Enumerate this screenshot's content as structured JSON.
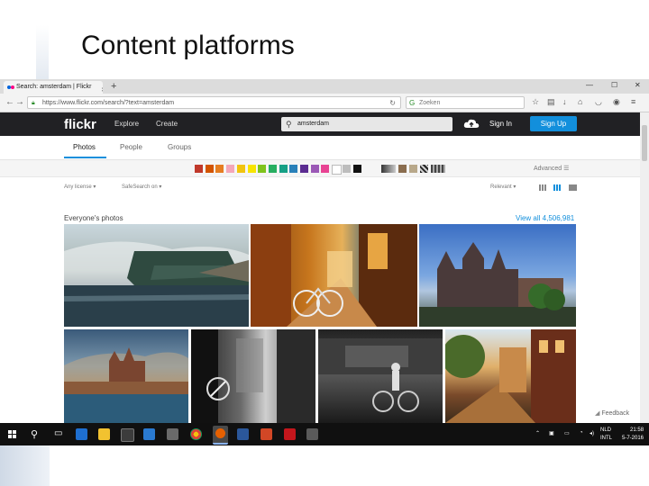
{
  "slide": {
    "title": "Content platforms"
  },
  "browser": {
    "tab_title": "Search: amsterdam | Flickr",
    "new_tab": "+",
    "url": "https://www.flickr.com/search/?text=amsterdam",
    "search_placeholder": "Zoeken"
  },
  "flickr": {
    "logo": "flickr",
    "nav": [
      "Explore",
      "Create"
    ],
    "search_value": "amsterdam",
    "sign_in": "Sign In",
    "sign_up": "Sign Up",
    "tabs": [
      "Photos",
      "People",
      "Groups"
    ],
    "active_tab": "Photos",
    "advanced": "Advanced",
    "filters": {
      "license": "Any license ▾",
      "safesearch": "SafeSearch on ▾",
      "relevant": "Relevant ▾"
    },
    "section_title": "Everyone's photos",
    "view_all": "View all 4,506,981",
    "feedback": "Feedback",
    "colors": [
      "#c0392b",
      "#d35400",
      "#e67e22",
      "#f4a7b9",
      "#f1c40f",
      "#f7e400",
      "#7fc31c",
      "#27ae60",
      "#16a085",
      "#2980b9",
      "#5b2c91",
      "#9b59b6",
      "#e84393",
      "#ffffff",
      "#bdbdbd",
      "#111111"
    ]
  },
  "taskbar": {
    "lang": [
      "NLD",
      "INTL"
    ],
    "time": "21:58",
    "date": "5-7-2016"
  }
}
